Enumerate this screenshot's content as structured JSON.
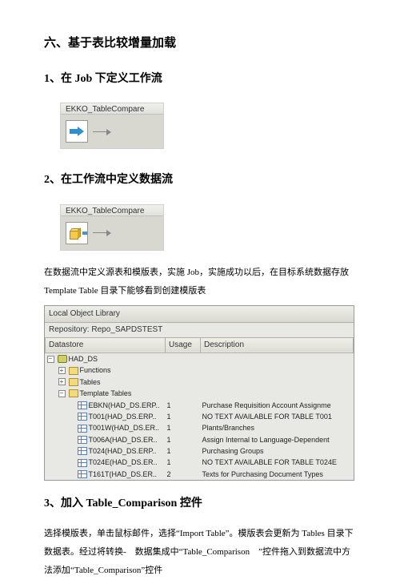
{
  "headings": {
    "h1": "六、基于表比较增量加载",
    "h2_1_pre": "1、在 ",
    "h2_1_mid": "Job",
    "h2_1_post": " 下定义工作流",
    "h2_2": "2、在工作流中定义数据流",
    "h2_3_pre": "3、加入 ",
    "h2_3_mid": "Table_Comparison",
    "h2_3_post": " 控件"
  },
  "screenshot1": {
    "title": "EKKO_TableCompare"
  },
  "screenshot2": {
    "title": "EKKO_TableCompare"
  },
  "para1": "在数据流中定义源表和模版表，实施 Job，实施成功以后，在目标系统数据存放 Template Table 目录下能够看到创建模版表",
  "panel": {
    "title": "Local Object Library",
    "repo_label": "Repository:",
    "repo_value": "Repo_SAPDSTEST",
    "headers": {
      "c1": "Datastore",
      "c2": "Usage",
      "c3": "Description"
    },
    "tree": {
      "root": "HAD_DS",
      "functions": "Functions",
      "tables": "Tables",
      "template_tables": "Template Tables"
    },
    "rows": [
      {
        "name": "EBKN(HAD_DS.ERP..",
        "usage": "1",
        "desc": "Purchase Requisition Account Assignme"
      },
      {
        "name": "T001(HAD_DS.ERP..",
        "usage": "1",
        "desc": "NO TEXT AVAILABLE FOR TABLE T001"
      },
      {
        "name": "T001W(HAD_DS.ER..",
        "usage": "1",
        "desc": "Plants/Branches"
      },
      {
        "name": "T006A(HAD_DS.ER..",
        "usage": "1",
        "desc": "Assign Internal to Language-Dependent"
      },
      {
        "name": "T024(HAD_DS.ERP..",
        "usage": "1",
        "desc": "Purchasing Groups"
      },
      {
        "name": "T024E(HAD_DS.ER..",
        "usage": "1",
        "desc": "NO TEXT AVAILABLE FOR TABLE T024E"
      },
      {
        "name": "T161T(HAD_DS.ER..",
        "usage": "2",
        "desc": "Texts for Purchasing Document Types"
      }
    ]
  },
  "para2": "选择模版表，单击鼠标邮件，选择“Import Table”。模版表会更新为 Tables 目录下数据表。经过将转换-　数据集成中“Table_Comparison　”控件拖入到数据流中方法添加“Table_Comparison”控件"
}
